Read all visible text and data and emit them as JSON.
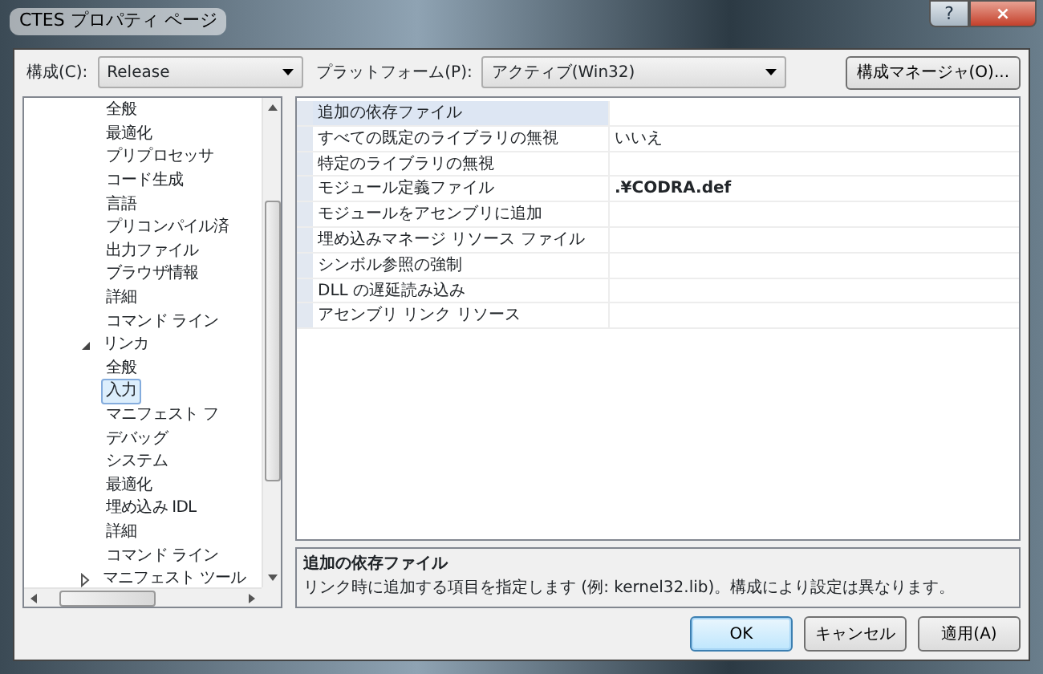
{
  "window": {
    "title": "CTES プロパティ ページ",
    "buttons": [
      "?",
      "×"
    ]
  },
  "toolbar": {
    "config_label": "構成(C):",
    "config_value": "Release",
    "platform_label": "プラットフォーム(P):",
    "platform_value": "アクティブ(Win32)",
    "manager_button": "構成マネージャ(O)..."
  },
  "tree": {
    "continued_children": [
      {
        "label": "全般",
        "selected": false
      },
      {
        "label": "最適化",
        "selected": false
      },
      {
        "label": "プリプロセッサ",
        "selected": false
      },
      {
        "label": "コード生成",
        "selected": false
      },
      {
        "label": "言語",
        "selected": false
      },
      {
        "label": "プリコンパイル済",
        "selected": false
      },
      {
        "label": "出力ファイル",
        "selected": false
      },
      {
        "label": "ブラウザ情報",
        "selected": false
      },
      {
        "label": "詳細",
        "selected": false
      },
      {
        "label": "コマンド ライン",
        "selected": false
      }
    ],
    "nodes": [
      {
        "label": "リンカ",
        "expanded": true,
        "selected": false,
        "children": [
          {
            "label": "全般",
            "selected": false
          },
          {
            "label": "入力",
            "selected": true
          },
          {
            "label": "マニフェスト フ",
            "selected": false
          },
          {
            "label": "デバッグ",
            "selected": false
          },
          {
            "label": "システム",
            "selected": false
          },
          {
            "label": "最適化",
            "selected": false
          },
          {
            "label": "埋め込み IDL",
            "selected": false
          },
          {
            "label": "詳細",
            "selected": false
          },
          {
            "label": "コマンド ライン",
            "selected": false
          }
        ]
      },
      {
        "label": "マニフェスト ツール",
        "expanded": false,
        "selected": false
      }
    ]
  },
  "properties": [
    {
      "name": "追加の依存ファイル",
      "selected": true
    },
    {
      "name": "すべての既定のライブラリの無視",
      "value": "いいえ",
      "selected": false,
      "bold": false
    },
    {
      "name": "特定のライブラリの無視",
      "selected": false
    },
    {
      "name": "モジュール定義ファイル",
      "value": ".¥CODRA.def",
      "selected": false,
      "bold": true
    },
    {
      "name": "モジュールをアセンブリに追加",
      "selected": false
    },
    {
      "name": "埋め込みマネージ リソース ファイル",
      "selected": false
    },
    {
      "name": "シンボル参照の強制",
      "selected": false
    },
    {
      "name": "DLL の遅延読み込み",
      "selected": false
    },
    {
      "name": "アセンブリ リンク リソース",
      "selected": false
    }
  ],
  "description": {
    "title": "追加の依存ファイル",
    "text": "リンク時に追加する項目を指定します (例: kernel32.lib)。構成により設定は異なります。"
  },
  "buttons": [
    {
      "label": "OK",
      "default": true
    },
    {
      "label": "キャンセル",
      "default": false
    },
    {
      "label": "適用(A)",
      "default": false
    }
  ]
}
